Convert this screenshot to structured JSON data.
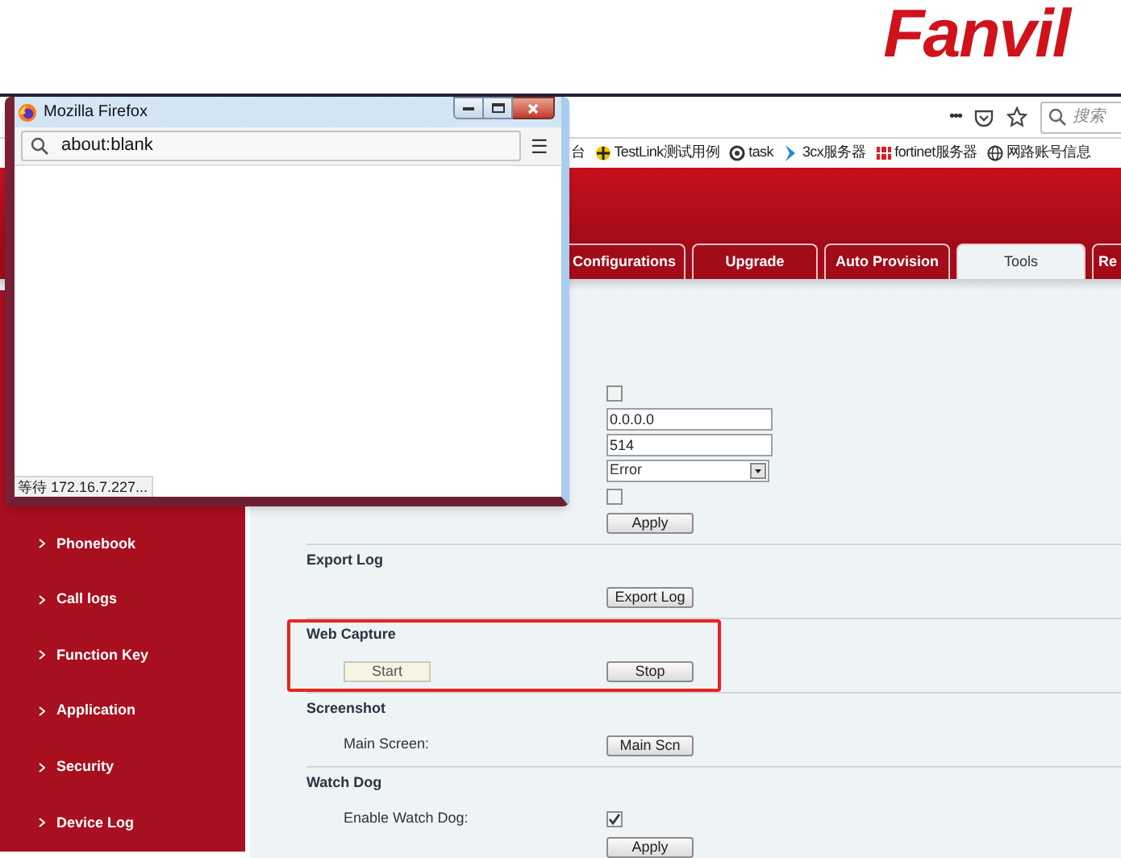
{
  "logo": {
    "text": "Fanvil"
  },
  "browser": {
    "toolbar": {
      "menu": "•••",
      "search_placeholder": "搜索"
    },
    "bookmarks": [
      {
        "label": "台",
        "kind": "none"
      },
      {
        "label": "TestLink测试用例",
        "kind": "testlink"
      },
      {
        "label": "task",
        "kind": "task"
      },
      {
        "label": "3cx服务器",
        "kind": "chevron"
      },
      {
        "label": "fortinet服务器",
        "kind": "fortinet"
      },
      {
        "label": "网路账号信息",
        "kind": "globe"
      }
    ]
  },
  "tabs": [
    {
      "label": "Configurations",
      "selected": false
    },
    {
      "label": "Upgrade",
      "selected": false
    },
    {
      "label": "Auto Provision",
      "selected": false
    },
    {
      "label": "Tools",
      "selected": true
    },
    {
      "label": "Re",
      "selected": false
    }
  ],
  "sidebar": {
    "items": [
      {
        "label": "Phonebook",
        "selected": false
      },
      {
        "label": "Call logs",
        "selected": false
      },
      {
        "label": "Function Key",
        "selected": false
      },
      {
        "label": "Application",
        "selected": false
      },
      {
        "label": "Security",
        "selected": false
      },
      {
        "label": "Device Log",
        "selected": false
      }
    ]
  },
  "syslog": {
    "enable_checked": false,
    "server": "0.0.0.0",
    "port": "514",
    "level": "Error",
    "extra_checked": false,
    "apply": "Apply"
  },
  "sections": [
    {
      "title": "Export Log",
      "highlighted": false,
      "rows": [
        {
          "kind": "buttons",
          "buttons": [
            {
              "label": "Export Log",
              "disabled": false
            }
          ]
        }
      ]
    },
    {
      "title": "Web Capture",
      "highlighted": true,
      "rows": [
        {
          "kind": "buttons",
          "buttons": [
            {
              "label": "Start",
              "disabled": true
            },
            {
              "label": "Stop",
              "disabled": false
            }
          ]
        }
      ]
    },
    {
      "title": "Screenshot",
      "highlighted": false,
      "rows": [
        {
          "kind": "buttons",
          "label": "Main Screen:",
          "buttons": [
            {
              "label": "Main Scn",
              "disabled": false
            }
          ]
        }
      ]
    },
    {
      "title": "Watch Dog",
      "highlighted": false,
      "rows": [
        {
          "kind": "checkbox",
          "label": "Enable Watch Dog:",
          "checked": true
        },
        {
          "kind": "buttons",
          "buttons": [
            {
              "label": "Apply",
              "disabled": false
            }
          ]
        }
      ]
    }
  ],
  "popup": {
    "title": "Mozilla Firefox",
    "address": "about:blank",
    "menu": "☰",
    "status": "等待 172.16.7.227..."
  }
}
